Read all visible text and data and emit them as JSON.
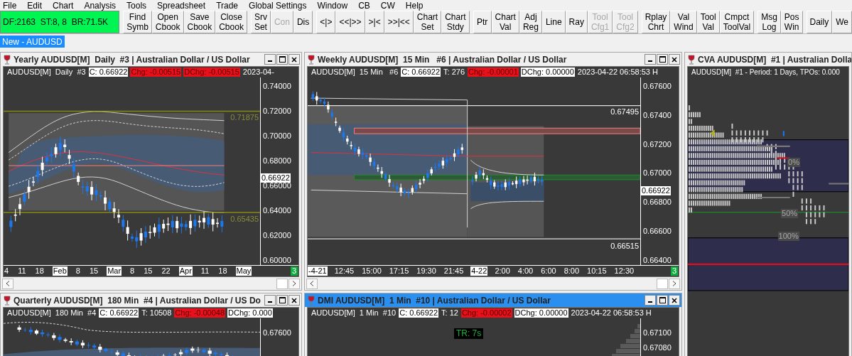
{
  "menu": [
    "File",
    "Edit",
    "Chart",
    "Analysis",
    "Tools",
    "Spreadsheet",
    "Trade",
    "Global Settings",
    "Window",
    "CB",
    "CW",
    "Help"
  ],
  "status_panel": {
    "text": "DF:2163  ST:8, 8  BR:71.5K"
  },
  "toolbar": [
    [
      {
        "lines": [
          "Find",
          "Symb"
        ],
        "disabled": false
      },
      {
        "lines": [
          "Open",
          "Cbook"
        ],
        "disabled": false
      },
      {
        "lines": [
          "Save",
          "Cbook"
        ],
        "disabled": false
      },
      {
        "lines": [
          "Close",
          "Cbook"
        ],
        "disabled": false
      }
    ],
    [
      {
        "lines": [
          "Srv",
          "Set"
        ],
        "disabled": false
      },
      {
        "lines": [
          "Con"
        ],
        "disabled": true
      },
      {
        "lines": [
          "Dis"
        ],
        "disabled": false
      }
    ],
    [
      {
        "lines": [
          "<|>"
        ],
        "disabled": false
      },
      {
        "lines": [
          "<<|>>"
        ],
        "disabled": false
      },
      {
        "lines": [
          ">|<"
        ],
        "disabled": false
      },
      {
        "lines": [
          ">>|<<"
        ],
        "disabled": false
      },
      {
        "lines": [
          "Chart",
          "Set"
        ],
        "disabled": false
      },
      {
        "lines": [
          "Chart",
          "Stdy"
        ],
        "disabled": false
      }
    ],
    [
      {
        "lines": [
          "Ptr"
        ],
        "disabled": false
      },
      {
        "lines": [
          "Chart",
          "Val"
        ],
        "disabled": false
      },
      {
        "lines": [
          "Adj",
          "Reg"
        ],
        "disabled": false
      },
      {
        "lines": [
          "Line"
        ],
        "disabled": false
      },
      {
        "lines": [
          "Ray"
        ],
        "disabled": false
      },
      {
        "lines": [
          "Tool",
          "Cfg1"
        ],
        "disabled": true
      },
      {
        "lines": [
          "Tool",
          "Cfg2"
        ],
        "disabled": true
      }
    ],
    [
      {
        "lines": [
          "Rplay",
          "Chrt"
        ],
        "disabled": false
      },
      {
        "lines": [
          "Val",
          "Wind"
        ],
        "disabled": false
      },
      {
        "lines": [
          "Tool",
          "Val"
        ],
        "disabled": false
      },
      {
        "lines": [
          "Cmpct",
          "ToolVal"
        ],
        "disabled": false
      }
    ],
    [
      {
        "lines": [
          "Msg",
          "Log"
        ],
        "disabled": false
      },
      {
        "lines": [
          "Pos",
          "Win"
        ],
        "disabled": false
      }
    ],
    [
      {
        "lines": [
          "Daily"
        ],
        "disabled": false
      },
      {
        "lines": [
          "We"
        ],
        "disabled": false
      }
    ]
  ],
  "tabs": [
    {
      "label": "New - AUDUSD",
      "selected": true
    }
  ],
  "windows": [
    {
      "kind": "range",
      "title": "Yearly AUDUSD[M]  Daily  #3 | Australian Dollar / US Dollar",
      "active": false,
      "info": [
        {
          "text": "AUDUSD[M]  Daily  #3",
          "boxed": false,
          "negative": false
        },
        {
          "text": "C: 0.66922",
          "boxed": true,
          "negative": false
        },
        {
          "text": "Chg: -0.00515",
          "boxed": true,
          "negative": true
        },
        {
          "text": "DChg: -0.00515",
          "boxed": true,
          "negative": true
        },
        {
          "text": "2023-04-",
          "boxed": false,
          "negative": false
        }
      ],
      "y_ticks": [
        "0.74000",
        "0.72000",
        "0.70000",
        "0.68000",
        "0.66000",
        "0.64000",
        "0.62000",
        "0.60000"
      ],
      "price_marker": "0.66922",
      "levels": [
        "0.71875",
        "0.65435"
      ],
      "x_ticks": [
        {
          "label": "4",
          "boxed": false
        },
        {
          "label": "11",
          "boxed": false
        },
        {
          "label": "18",
          "boxed": false
        },
        {
          "label": "Feb",
          "boxed": true
        },
        {
          "label": "8",
          "boxed": false
        },
        {
          "label": "15",
          "boxed": false
        },
        {
          "label": "Mar",
          "boxed": true
        },
        {
          "label": "8",
          "boxed": false
        },
        {
          "label": "15",
          "boxed": false
        },
        {
          "label": "22",
          "boxed": false
        },
        {
          "label": "Apr",
          "boxed": true
        },
        {
          "label": "11",
          "boxed": false
        },
        {
          "label": "18",
          "boxed": false
        },
        {
          "label": "May",
          "boxed": true
        }
      ],
      "badge": "3"
    },
    {
      "kind": "session",
      "title": "Weekly AUDUSD[M]  15 Min   #6 | Australian Dollar / US Dollar",
      "active": false,
      "info": [
        {
          "text": "AUDUSD[M]  15 Min   #6",
          "boxed": false,
          "negative": false
        },
        {
          "text": "C: 0.66922",
          "boxed": true,
          "negative": false
        },
        {
          "text": "T: 276",
          "boxed": false,
          "negative": false
        },
        {
          "text": "Chg: -0.00001",
          "boxed": true,
          "negative": true
        },
        {
          "text": "DChg: 0.00000",
          "boxed": true,
          "negative": false
        },
        {
          "text": "2023-04-22 06:58:53 H",
          "boxed": false,
          "negative": false
        }
      ],
      "y_ticks": [
        "0.67600",
        "0.67400",
        "0.67200",
        "0.67000",
        "0.66800",
        "0.66600",
        "0.66400"
      ],
      "price_marker": "0.66922",
      "levels": [
        "0.67495",
        "0.66515"
      ],
      "x_ticks": [
        {
          "label": "-4-21",
          "boxed": true
        },
        {
          "label": "12:45",
          "boxed": false
        },
        {
          "label": "15:00",
          "boxed": false
        },
        {
          "label": "17:15",
          "boxed": false
        },
        {
          "label": "19:30",
          "boxed": false
        },
        {
          "label": "21:45",
          "boxed": false
        },
        {
          "label": "4-22",
          "boxed": true
        },
        {
          "label": "2:00",
          "boxed": false
        },
        {
          "label": "4:00",
          "boxed": false
        },
        {
          "label": "6:00",
          "boxed": false
        },
        {
          "label": "8:00",
          "boxed": false
        },
        {
          "label": "10:15",
          "boxed": false
        },
        {
          "label": "12:30",
          "boxed": false
        }
      ],
      "badge": "3"
    },
    {
      "kind": "profile",
      "title": "CVA AUDUSD[M]  #1 | Australian Dolla",
      "active": false,
      "info": [
        {
          "text": "AUDUSD[M]  #1 - Period: 1 Days, TPOs: 0.000",
          "boxed": false,
          "negative": false
        }
      ],
      "labels": [
        "0%",
        "50%",
        "100%"
      ]
    },
    {
      "kind": "band",
      "title": "Quarterly AUDUSD[M]  180 Min  #4 | Australian Dollar / US Do",
      "active": false,
      "info": [
        {
          "text": "AUDUSD[M]  180 Min  #4",
          "boxed": false,
          "negative": false
        },
        {
          "text": "C: 0.66922",
          "boxed": true,
          "negative": false
        },
        {
          "text": "T: 10508",
          "boxed": false,
          "negative": false
        },
        {
          "text": "Chg: -0.00048",
          "boxed": true,
          "negative": true
        },
        {
          "text": "DChg: 0.000",
          "boxed": true,
          "negative": false
        }
      ],
      "y_ticks": [
        "0.67600"
      ]
    },
    {
      "kind": "dmi",
      "title": "DMI AUDUSD[M]  1 Min  #10 | Australian Dollar / US Dollar",
      "active": true,
      "info": [
        {
          "text": "AUDUSD[M]  1 Min  #10",
          "boxed": false,
          "negative": false
        },
        {
          "text": "C: 0.66922",
          "boxed": true,
          "negative": false
        },
        {
          "text": "T: 12",
          "boxed": false,
          "negative": false
        },
        {
          "text": "Chg: -0.00002",
          "boxed": true,
          "negative": true
        },
        {
          "text": "DChg: 0.00000",
          "boxed": true,
          "negative": false
        },
        {
          "text": "2023-04-22 06:58:53 H",
          "boxed": false,
          "negative": false
        }
      ],
      "y_ticks": [
        "0.67100",
        "0.67080"
      ],
      "timer": "TR: 7s"
    }
  ]
}
